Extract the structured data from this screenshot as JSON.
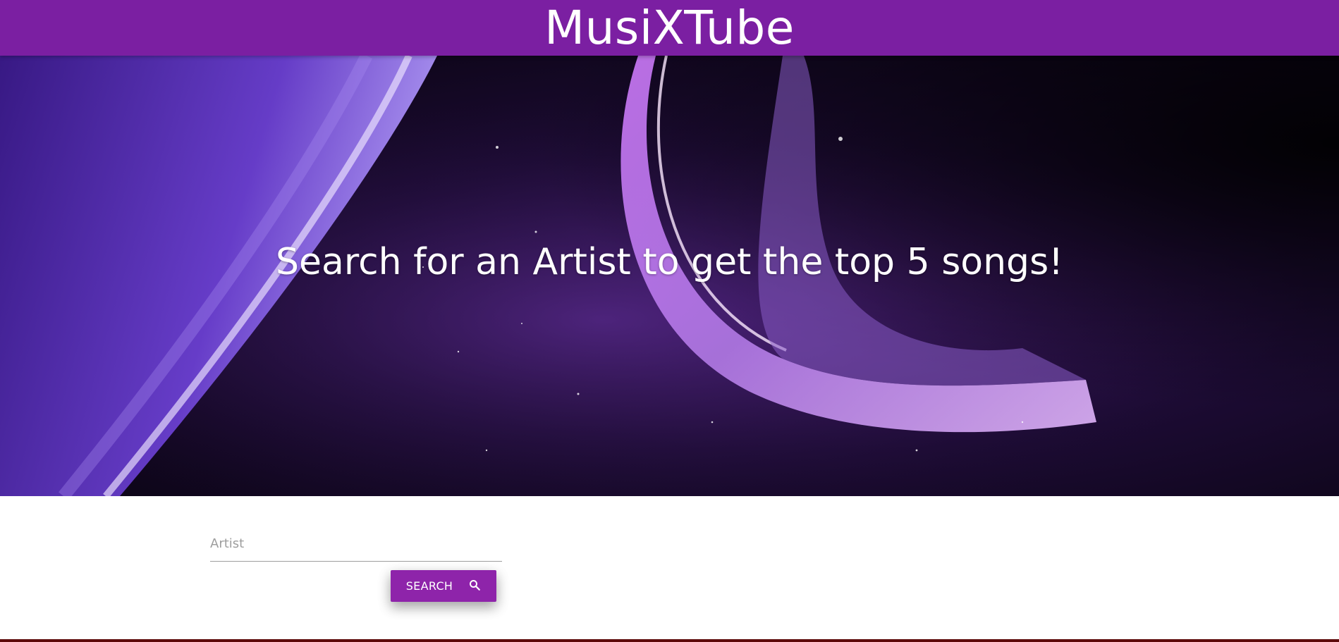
{
  "header": {
    "title": "MusiXTube"
  },
  "hero": {
    "headline": "Search for an Artist to get the top 5 songs!"
  },
  "search": {
    "placeholder": "Artist",
    "value": "",
    "button_label": "SEARCH",
    "button_icon": "search-icon"
  },
  "colors": {
    "primary": "#7b1fa2",
    "button": "#8e24aa"
  }
}
